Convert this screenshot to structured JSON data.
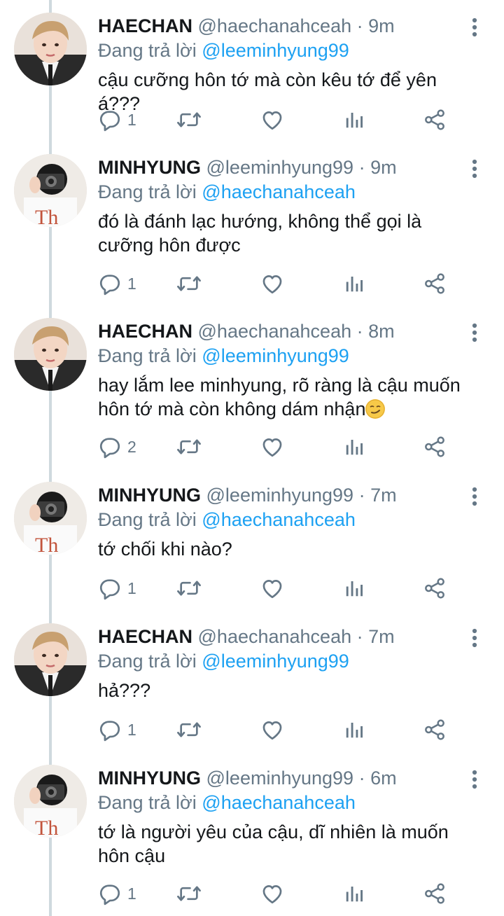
{
  "tweets": [
    {
      "author": "haechan",
      "name": "HAECHAN",
      "handle": "@haechanahceah",
      "dot": "·",
      "time": "9m",
      "reply_prefix": "Đang trả lời",
      "reply_to": "@leeminhyung99",
      "text": "cậu cưỡng hôn tớ mà còn kêu tớ để yên á???",
      "replies": "1"
    },
    {
      "author": "minhyung",
      "name": "MINHYUNG",
      "handle": "@leeminhyung99",
      "dot": "·",
      "time": "9m",
      "reply_prefix": "Đang trả lời",
      "reply_to": "@haechanahceah",
      "text": "đó là đánh lạc hướng, không thể gọi là cưỡng hôn được",
      "replies": "1"
    },
    {
      "author": "haechan",
      "name": "HAECHAN",
      "handle": "@haechanahceah",
      "dot": "·",
      "time": "8m",
      "reply_prefix": "Đang trả lời",
      "reply_to": "@leeminhyung99",
      "text": "hay lắm lee minhyung, rõ ràng là cậu muốn hôn tớ mà còn không dám nhận",
      "emoji": "smirk",
      "replies": "2"
    },
    {
      "author": "minhyung",
      "name": "MINHYUNG",
      "handle": "@leeminhyung99",
      "dot": "·",
      "time": "7m",
      "reply_prefix": "Đang trả lời",
      "reply_to": "@haechanahceah",
      "text": "tớ chối khi nào?",
      "replies": "1"
    },
    {
      "author": "haechan",
      "name": "HAECHAN",
      "handle": "@haechanahceah",
      "dot": "·",
      "time": "7m",
      "reply_prefix": "Đang trả lời",
      "reply_to": "@leeminhyung99",
      "text": "hả???",
      "replies": "1"
    },
    {
      "author": "minhyung",
      "name": "MINHYUNG",
      "handle": "@leeminhyung99",
      "dot": "·",
      "time": "6m",
      "reply_prefix": "Đang trả lời",
      "reply_to": "@haechanahceah",
      "text": "tớ là người yêu của cậu, dĩ nhiên là muốn hôn cậu",
      "replies": "1"
    }
  ],
  "colors": {
    "link": "#1da1f2",
    "secondary": "#657786",
    "text": "#14171a",
    "thread_line": "#cfd9de"
  },
  "icons": [
    "reply-icon",
    "retweet-icon",
    "like-icon",
    "analytics-icon",
    "share-icon",
    "more-icon"
  ]
}
